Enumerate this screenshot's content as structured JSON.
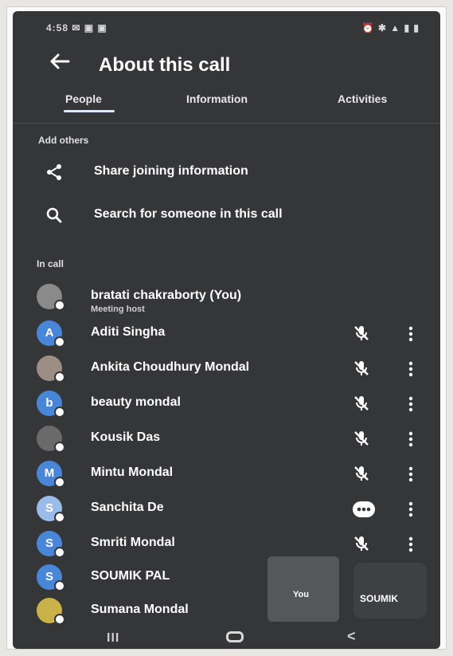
{
  "status": {
    "left": "4:58 ✉ ▣ ▣",
    "right": "⏰ ✱ ▲ ▮ ▮"
  },
  "header": {
    "title": "About this call"
  },
  "tabs": [
    {
      "label": "People",
      "selected": true
    },
    {
      "label": "Information",
      "selected": false
    },
    {
      "label": "Activities",
      "selected": false
    }
  ],
  "add_others": {
    "heading": "Add others",
    "share_label": "Share joining information",
    "search_label": "Search for someone in this call"
  },
  "in_call": {
    "heading": "In call",
    "participants": [
      {
        "name": "bratati chakraborty (You)",
        "subtitle": "Meeting host",
        "initial": "",
        "avatar_color": "#8a8a8a",
        "mic": "none",
        "more": false
      },
      {
        "name": "Aditi Singha",
        "initial": "A",
        "avatar_color": "#4a86d8",
        "mic": "muted",
        "more": true
      },
      {
        "name": "Ankita Choudhury Mondal",
        "initial": "",
        "avatar_color": "#9c8e84",
        "mic": "muted",
        "more": true
      },
      {
        "name": "beauty mondal",
        "initial": "b",
        "avatar_color": "#4a86d8",
        "mic": "muted",
        "more": true
      },
      {
        "name": "Kousik Das",
        "initial": "",
        "avatar_color": "#6a6a6a",
        "mic": "muted",
        "more": true
      },
      {
        "name": "Mintu Mondal",
        "initial": "M",
        "avatar_color": "#4a86d8",
        "mic": "muted",
        "more": true
      },
      {
        "name": "Sanchita De",
        "initial": "S",
        "avatar_color": "#9bbce8",
        "mic": "speaking",
        "more": true
      },
      {
        "name": "Smriti Mondal",
        "initial": "S",
        "avatar_color": "#4a86d8",
        "mic": "muted",
        "more": true
      },
      {
        "name": "SOUMIK PAL",
        "initial": "S",
        "avatar_color": "#4a86d8",
        "mic": "none",
        "more": false
      },
      {
        "name": "Sumana Mondal",
        "initial": "",
        "avatar_color": "#c9b24a",
        "mic": "muted",
        "more": true
      }
    ]
  },
  "pip": {
    "you_label": "You",
    "other_label": "SOUMIK"
  },
  "nav": {
    "recents": "III",
    "back": "<"
  },
  "colors": {
    "background": "#343638",
    "accent": "#4a86d8",
    "text": "#ffffff"
  }
}
